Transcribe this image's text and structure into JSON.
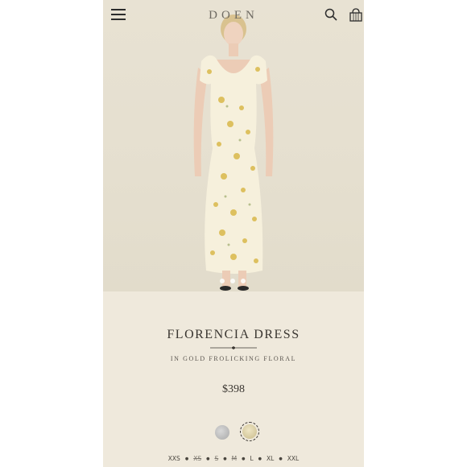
{
  "header": {
    "brand": "DOEN",
    "menu_icon": "hamburger-icon",
    "search_icon": "search-icon",
    "bag_icon": "shopping-bag-icon"
  },
  "gallery": {
    "image_alt": "Model wearing floral midi dress",
    "slide_count": 3,
    "active_slide": 1
  },
  "product": {
    "name": "FLORENCIA DRESS",
    "colorway": "IN GOLD FROLICKING FLORAL",
    "price": "$398",
    "swatches": [
      {
        "name": "swatch-grey",
        "color": "#b3b3b3",
        "selected": false
      },
      {
        "name": "swatch-gold-floral",
        "color": "#d9cfa6",
        "selected": true
      }
    ],
    "sizes": [
      {
        "label": "XXS",
        "available": true
      },
      {
        "label": "XS",
        "available": false
      },
      {
        "label": "S",
        "available": false
      },
      {
        "label": "M",
        "available": false
      },
      {
        "label": "L",
        "available": true
      },
      {
        "label": "XL",
        "available": true
      },
      {
        "label": "XXL",
        "available": true
      }
    ]
  },
  "colors": {
    "background": "#efe9dc",
    "text": "#3a3631",
    "dress": "#f6f0dc",
    "floral": "#d9b84a"
  }
}
